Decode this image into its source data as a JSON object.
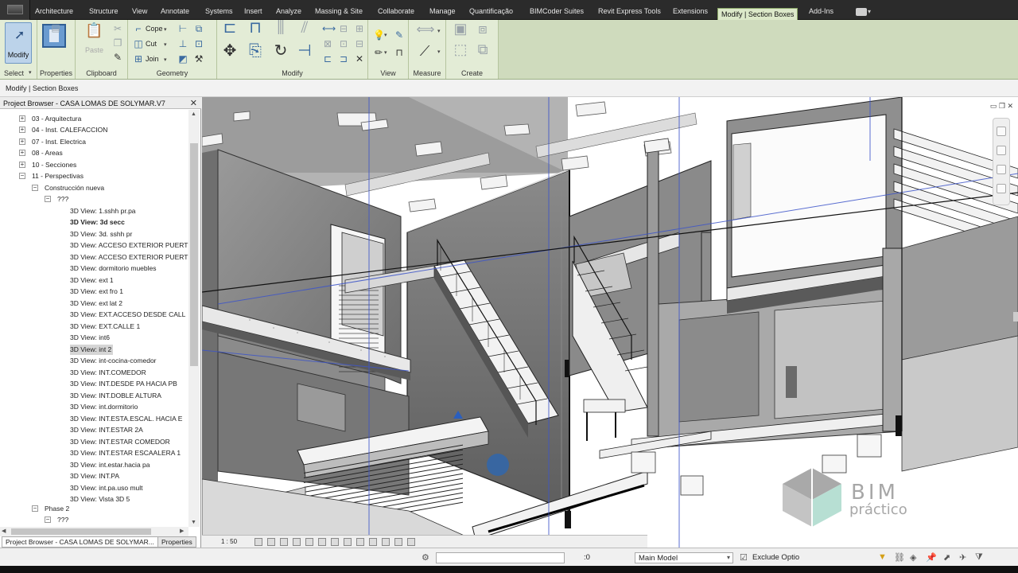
{
  "tabs": [
    {
      "label": "Architecture"
    },
    {
      "label": "Structure"
    },
    {
      "label": "View"
    },
    {
      "label": "Annotate"
    },
    {
      "label": "Systems"
    },
    {
      "label": "Insert"
    },
    {
      "label": "Analyze"
    },
    {
      "label": "Massing & Site"
    },
    {
      "label": "Collaborate"
    },
    {
      "label": "Manage"
    },
    {
      "label": "Quantificação"
    },
    {
      "label": "BIMCoder Suites"
    },
    {
      "label": "Revit Express Tools"
    },
    {
      "label": "Extensions"
    },
    {
      "label": "Modify | Section Boxes"
    },
    {
      "label": "Add-Ins"
    }
  ],
  "ribbon": {
    "select": {
      "modify_label": "Modify",
      "title": "Select"
    },
    "properties": {
      "title": "Properties"
    },
    "clipboard": {
      "paste_label": "Paste",
      "title": "Clipboard"
    },
    "geometry": {
      "cope_label": "Cope",
      "cut_label": "Cut",
      "join_label": "Join",
      "title": "Geometry"
    },
    "modify": {
      "title": "Modify"
    },
    "view": {
      "title": "View"
    },
    "measure": {
      "title": "Measure"
    },
    "create": {
      "title": "Create"
    }
  },
  "options_bar": {
    "context": "Modify | Section Boxes"
  },
  "project_browser": {
    "title": "Project Browser - CASA LOMAS DE SOLYMAR.V7",
    "items": [
      {
        "label": "03 - Arquitectura"
      },
      {
        "label": "04 - Inst. CALEFACCION"
      },
      {
        "label": "07 - Inst. Electrica"
      },
      {
        "label": "08 - Areas"
      },
      {
        "label": "10 - Secciones"
      },
      {
        "label": "11 - Perspectivas"
      },
      {
        "label": "Construcción nueva"
      },
      {
        "label": "???"
      },
      {
        "label": "3D View: 1.sshh pr.pa"
      },
      {
        "label": "3D View: 3d secc"
      },
      {
        "label": "3D View: 3d. sshh pr"
      },
      {
        "label": "3D View: ACCESO EXTERIOR PUERT"
      },
      {
        "label": "3D View: ACCESO EXTERIOR PUERT"
      },
      {
        "label": "3D View: dormitorio muebles"
      },
      {
        "label": "3D View: ext 1"
      },
      {
        "label": "3D View: ext fro 1"
      },
      {
        "label": "3D View: ext lat 2"
      },
      {
        "label": "3D View: EXT.ACCESO DESDE CALL"
      },
      {
        "label": "3D View: EXT.CALLE 1"
      },
      {
        "label": "3D View: int6"
      },
      {
        "label": "3D View: int 2"
      },
      {
        "label": "3D View: int-cocina-comedor"
      },
      {
        "label": "3D View: INT.COMEDOR"
      },
      {
        "label": "3D View: INT.DESDE PA HACIA PB"
      },
      {
        "label": "3D View: INT.DOBLE ALTURA"
      },
      {
        "label": "3D View: int.dormitorio"
      },
      {
        "label": "3D View: INT.ESTA.ESCAL. HACIA E"
      },
      {
        "label": "3D View: INT.ESTAR 2A"
      },
      {
        "label": "3D View: INT.ESTAR COMEDOR"
      },
      {
        "label": "3D View: INT.ESTAR ESCAALERA 1"
      },
      {
        "label": "3D View: int.estar.hacia pa"
      },
      {
        "label": "3D View: INT.PA"
      },
      {
        "label": "3D View: int.pa.uso mult"
      },
      {
        "label": "3D View: Vista 3D 5"
      },
      {
        "label": "Phase 2"
      },
      {
        "label": "???"
      }
    ],
    "bottom_tabs": [
      {
        "label": "Project Browser - CASA LOMAS DE SOLYMAR..."
      },
      {
        "label": "Properties"
      }
    ]
  },
  "view_control": {
    "scale": "1 : 50"
  },
  "status_bar": {
    "coord_value": ":0",
    "model_value": "Main Model",
    "exclude_label": "Exclude Optio"
  },
  "logo": {
    "line1": "BIM",
    "line2": "práctico"
  }
}
